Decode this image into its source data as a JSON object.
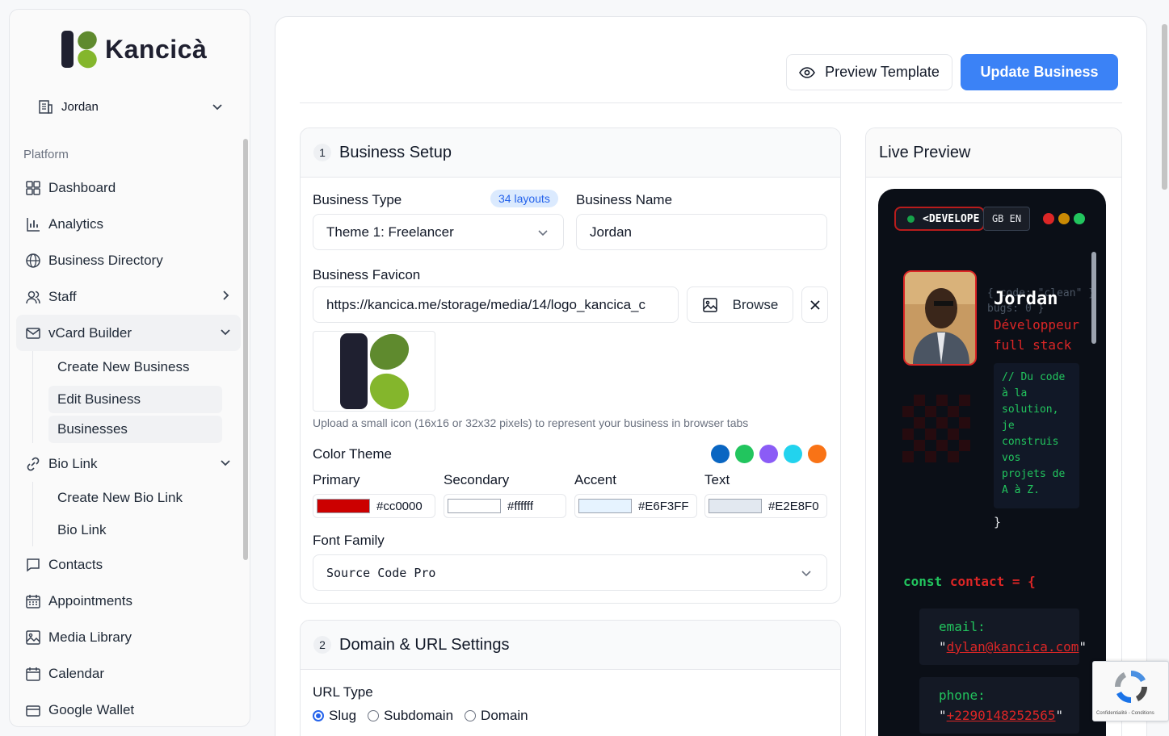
{
  "brand": {
    "name": "Kancicà"
  },
  "business_selector": {
    "value": "Jordan"
  },
  "sidebar": {
    "section_label": "Platform",
    "items": [
      {
        "label": "Dashboard",
        "icon": "grid-icon"
      },
      {
        "label": "Analytics",
        "icon": "bar-chart-icon"
      },
      {
        "label": "Business Directory",
        "icon": "globe-icon"
      },
      {
        "label": "Staff",
        "icon": "users-icon"
      },
      {
        "label": "vCard Builder",
        "icon": "mail-icon"
      },
      {
        "label": "Bio Link",
        "icon": "link-icon"
      },
      {
        "label": "Contacts",
        "icon": "message-square-icon"
      },
      {
        "label": "Appointments",
        "icon": "calendar-grid-icon"
      },
      {
        "label": "Media Library",
        "icon": "image-icon"
      },
      {
        "label": "Calendar",
        "icon": "calendar-icon"
      },
      {
        "label": "Google Wallet",
        "icon": "wallet-icon"
      }
    ],
    "vcard_sub": [
      "Create New Business",
      "Edit Business",
      "Businesses"
    ],
    "biolink_sub": [
      "Create New Bio Link",
      "Bio Link"
    ]
  },
  "toolbar": {
    "preview_label": "Preview Template",
    "update_label": "Update Business"
  },
  "business_setup": {
    "step": "1",
    "title": "Business Setup",
    "type_label": "Business Type",
    "layouts_badge": "34 layouts",
    "type_value": "Theme 1: Freelancer",
    "name_label": "Business Name",
    "name_value": "Jordan",
    "favicon_label": "Business Favicon",
    "favicon_url": "https://kancica.me/storage/media/14/logo_kancica_c",
    "browse_label": "Browse",
    "favicon_hint": "Upload a small icon (16x16 or 32x32 pixels) to represent your business in browser tabs",
    "color_theme_label": "Color Theme",
    "theme_swatches": [
      "#0a66c2",
      "#22c55e",
      "#8b5cf6",
      "#22d3ee",
      "#f97316"
    ],
    "colors": [
      {
        "label": "Primary",
        "value": "#cc0000",
        "swatch": "#cc0000"
      },
      {
        "label": "Secondary",
        "value": "#ffffff",
        "swatch": "#ffffff"
      },
      {
        "label": "Accent",
        "value": "#E6F3FF",
        "swatch": "#E6F3FF"
      },
      {
        "label": "Text",
        "value": "#E2E8F0",
        "swatch": "#E2E8F0"
      }
    ],
    "font_label": "Font Family",
    "font_value": "Source Code Pro"
  },
  "domain_settings": {
    "step": "2",
    "title": "Domain & URL Settings",
    "url_type_label": "URL Type",
    "options": [
      "Slug",
      "Subdomain",
      "Domain"
    ],
    "selected": "Slug"
  },
  "live_preview": {
    "title": "Live Preview",
    "topbar_text": "<DEVELOPE",
    "lang": "GB EN",
    "ghost_line1": "{ code: \"clean\" }",
    "ghost_line2": "bugs: 0 }",
    "name": "Jordan",
    "role": "Développeur full stack",
    "code_comment": "// Du code à la solution, je construis vos projets de A à Z.",
    "closing_brace": "}",
    "const_kw": "const",
    "const_var": "contact = {",
    "email_key": "email:",
    "email_value": "dylan@kancica.com",
    "phone_key": "phone:",
    "phone_value": "+2290148252565"
  },
  "recaptcha": {
    "text": "Confidentialité - Conditions"
  }
}
